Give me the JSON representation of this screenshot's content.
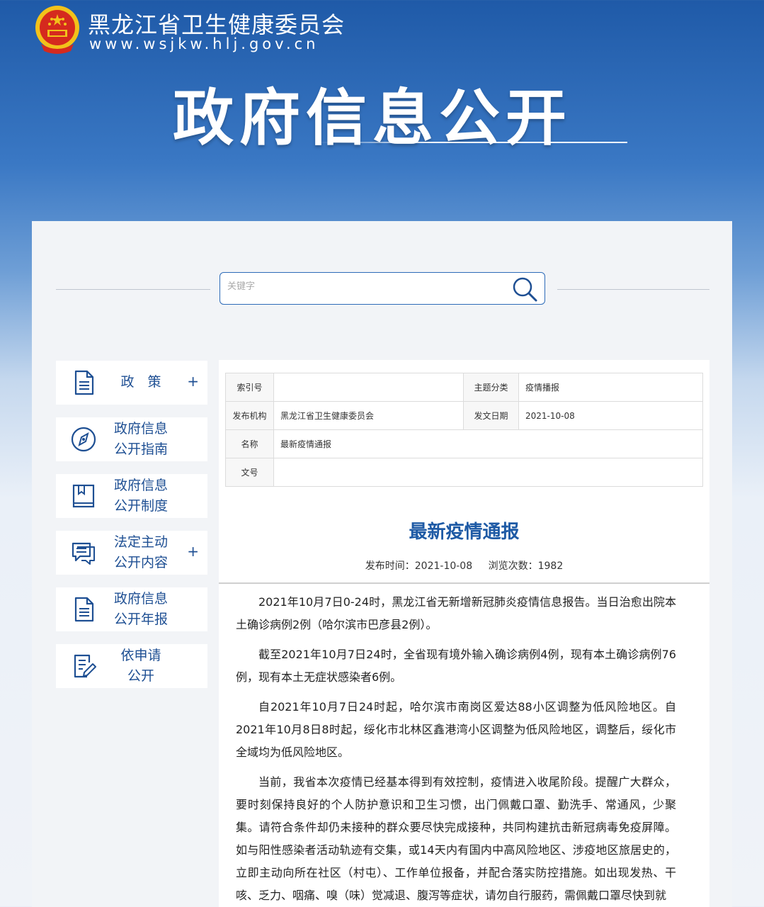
{
  "header": {
    "site_name": "黑龙江省卫生健康委员会",
    "site_url": "www.wsjkw.hlj.gov.cn",
    "banner_title": "政府信息公开",
    "colors": {
      "primary_blue": "#1e4f93",
      "banner_blue": "#1f5aa8",
      "emblem_red": "#d52a1e",
      "emblem_gold": "#f2c21a"
    }
  },
  "search": {
    "placeholder": "关键字"
  },
  "sidebar": {
    "items": [
      {
        "label": "政　策",
        "icon": "document-icon",
        "expandable": "+"
      },
      {
        "label": "政府信息\n公开指南",
        "icon": "compass-icon"
      },
      {
        "label": "政府信息\n公开制度",
        "icon": "book-icon"
      },
      {
        "label": "法定主动\n公开内容",
        "icon": "chat-list-icon",
        "expandable": "+"
      },
      {
        "label": "政府信息\n公开年报",
        "icon": "document-icon"
      },
      {
        "label": "依申请\n公开",
        "icon": "edit-document-icon"
      }
    ]
  },
  "meta": {
    "index_label": "索引号",
    "index_value": "",
    "topic_label": "主题分类",
    "topic_value": "疫情播报",
    "publisher_label": "发布机构",
    "publisher_value": "黑龙江省卫生健康委员会",
    "date_label": "发文日期",
    "date_value": "2021-10-08",
    "name_label": "名称",
    "name_value": "最新疫情通报",
    "docno_label": "文号",
    "docno_value": ""
  },
  "article": {
    "title": "最新疫情通报",
    "publish_time": "发布时间：2021-10-08",
    "views": "浏览次数：1982",
    "paragraphs": [
      "2021年10月7日0-24时，黑龙江省无新增新冠肺炎疫情信息报告。当日治愈出院本土确诊病例2例（哈尔滨市巴彦县2例）。",
      "截至2021年10月7日24时，全省现有境外输入确诊病例4例，现有本土确诊病例76例，现有本土无症状感染者6例。",
      "自2021年10月7日24时起，哈尔滨市南岗区爱达88小区调整为低风险地区。自2021年10月8日8时起，绥化市北林区鑫港湾小区调整为低风险地区，调整后，绥化市全域均为低风险地区。",
      "当前，我省本次疫情已经基本得到有效控制，疫情进入收尾阶段。提醒广大群众，要时刻保持良好的个人防护意识和卫生习惯，出门佩戴口罩、勤洗手、常通风，少聚集。请符合条件却仍未接种的群众要尽快完成接种，共同构建抗击新冠病毒免疫屏障。如与阳性感染者活动轨迹有交集，或14天内有国内中高风险地区、涉疫地区旅居史的，立即主动向所在社区（村屯）、工作单位报备，并配合落实防控措施。如出现发热、干咳、乏力、咽痛、嗅（味）觉减退、腹泻等症状，请勿自行服药，需佩戴口罩尽快到就"
    ]
  }
}
